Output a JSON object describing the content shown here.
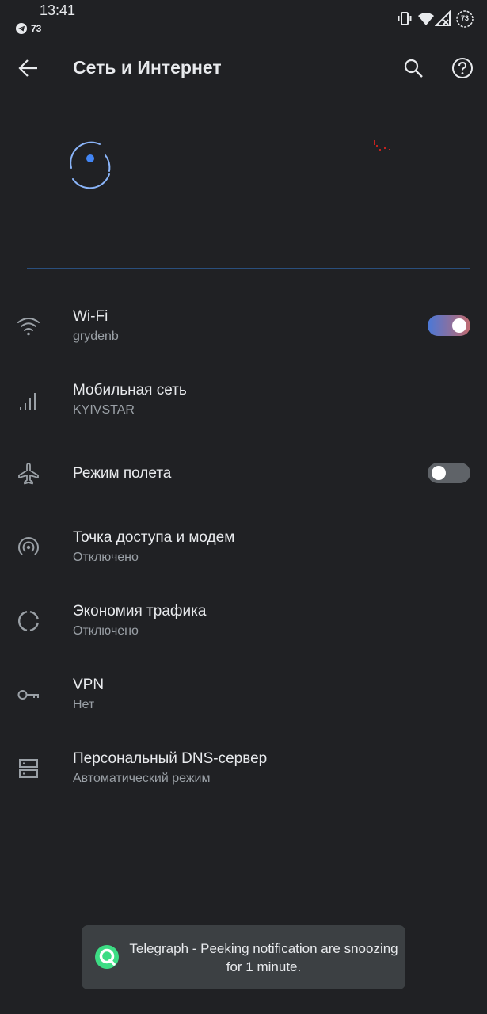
{
  "status_bar": {
    "time": "13:41",
    "notification_count": "73",
    "battery_level": "73",
    "icons": [
      "telegram-icon",
      "vibrate-icon",
      "wifi-icon",
      "no-signal-icon",
      "battery-icon"
    ]
  },
  "toolbar": {
    "title": "Сеть и Интернет",
    "icons": [
      "back-arrow-icon",
      "search-icon",
      "help-icon"
    ]
  },
  "settings": [
    {
      "title": "Wi-Fi",
      "summary": "grydenb",
      "icon": "wifi-icon",
      "toggle": true
    },
    {
      "title": "Мобильная сеть",
      "summary": "KYIVSTAR",
      "icon": "cellular-signal-icon"
    },
    {
      "title": "Режим полета",
      "icon": "airplane-icon",
      "toggle": false
    },
    {
      "title": "Точка доступа и модем",
      "summary": "Отключено",
      "icon": "hotspot-icon"
    },
    {
      "title": "Экономия трафика",
      "summary": "Отключено",
      "icon": "data-saver-icon"
    },
    {
      "title": "VPN",
      "summary": "Нет",
      "icon": "vpn-key-icon"
    },
    {
      "title": "Персональный DNS-сервер",
      "summary": "Автоматический режим",
      "icon": "dns-icon"
    }
  ],
  "toast": {
    "message": "Telegraph - Peeking notification are snoozing for 1 minute.",
    "icon": "app-icon"
  },
  "colors": {
    "background": "#202124",
    "text_primary": "#e8eaed",
    "text_secondary": "#9aa0a6",
    "accent": "#4a78d8",
    "toggle_on_end": "#c26a6e",
    "toast_background": "#3c4043"
  }
}
